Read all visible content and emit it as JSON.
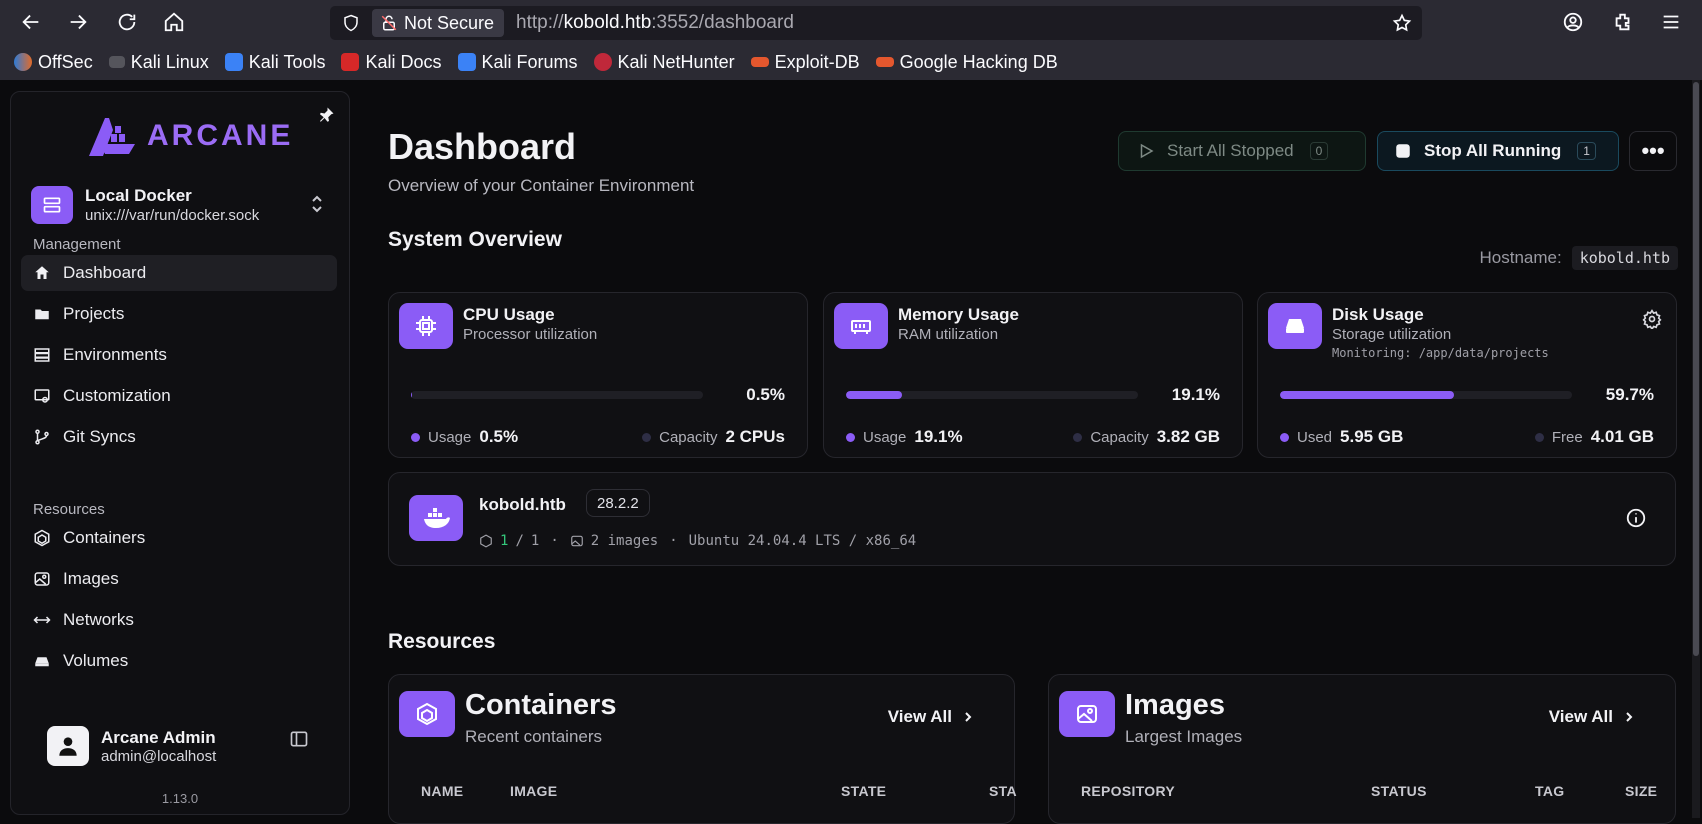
{
  "browser": {
    "not_secure": "Not Secure",
    "url_prefix": "http://",
    "url_host": "kobold.htb",
    "url_rest": ":3552/dashboard",
    "bookmarks": [
      "OffSec",
      "Kali Linux",
      "Kali Tools",
      "Kali Docs",
      "Kali Forums",
      "Kali NetHunter",
      "Exploit-DB",
      "Google Hacking DB"
    ]
  },
  "sidebar": {
    "logo": "ARCANE",
    "env_name": "Local Docker",
    "env_socket": "unix:///var/run/docker.sock",
    "management_label": "Management",
    "management": [
      {
        "label": "Dashboard",
        "icon": "home-icon"
      },
      {
        "label": "Projects",
        "icon": "folder-icon"
      },
      {
        "label": "Environments",
        "icon": "server-icon"
      },
      {
        "label": "Customization",
        "icon": "customize-icon"
      },
      {
        "label": "Git Syncs",
        "icon": "git-icon"
      }
    ],
    "resources_label": "Resources",
    "resources": [
      {
        "label": "Containers",
        "icon": "container-icon"
      },
      {
        "label": "Images",
        "icon": "image-icon"
      },
      {
        "label": "Networks",
        "icon": "network-icon"
      },
      {
        "label": "Volumes",
        "icon": "volume-icon"
      }
    ],
    "user_name": "Arcane Admin",
    "user_email": "admin@localhost",
    "version": "1.13.0"
  },
  "header": {
    "title": "Dashboard",
    "subtitle": "Overview of your Container Environment",
    "start_label": "Start All Stopped",
    "start_count": "0",
    "stop_label": "Stop All Running",
    "stop_count": "1"
  },
  "overview": {
    "title": "System Overview",
    "hostname_label": "Hostname:",
    "hostname": "kobold.htb",
    "cards": [
      {
        "title": "CPU Usage",
        "subtitle": "Processor utilization",
        "percent": "0.5%",
        "fill": 0.5,
        "a_label": "Usage",
        "a_value": "0.5%",
        "b_label": "Capacity",
        "b_value": "2 CPUs"
      },
      {
        "title": "Memory Usage",
        "subtitle": "RAM utilization",
        "percent": "19.1%",
        "fill": 19.1,
        "a_label": "Usage",
        "a_value": "19.1%",
        "b_label": "Capacity",
        "b_value": "3.82 GB"
      },
      {
        "title": "Disk Usage",
        "subtitle": "Storage utilization",
        "monitoring": "Monitoring: /app/data/projects",
        "percent": "59.7%",
        "fill": 59.7,
        "a_label": "Used",
        "a_value": "5.95 GB",
        "b_label": "Free",
        "b_value": "4.01 GB"
      }
    ]
  },
  "host": {
    "name": "kobold.htb",
    "version": "28.2.2",
    "running": "1",
    "total": "1",
    "images": "2 images",
    "os": "Ubuntu 24.04.4 LTS / x86_64"
  },
  "resources": {
    "title": "Resources",
    "containers": {
      "title": "Containers",
      "subtitle": "Recent containers",
      "view_all": "View All",
      "cols": [
        "NAME",
        "IMAGE",
        "STATE",
        "STA"
      ]
    },
    "images": {
      "title": "Images",
      "subtitle": "Largest Images",
      "view_all": "View All",
      "cols": [
        "REPOSITORY",
        "STATUS",
        "TAG",
        "SIZE"
      ]
    }
  },
  "colors": {
    "accent": "#8b5cf6",
    "bg": "#0b0b0d",
    "card": "#101013"
  }
}
